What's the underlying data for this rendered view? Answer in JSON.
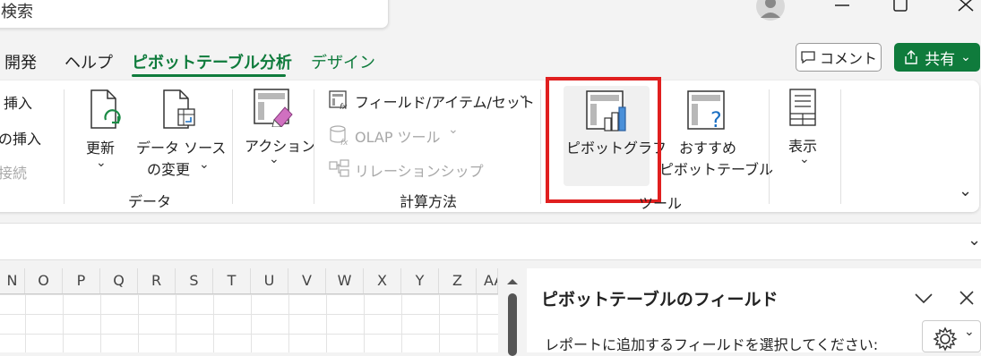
{
  "search": {
    "text": "検索"
  },
  "tabs": [
    {
      "label": "開発"
    },
    {
      "label": "ヘルプ"
    },
    {
      "label": "ピボットテーブル分析"
    },
    {
      "label": "デザイン"
    }
  ],
  "header": {
    "comment": "コメント",
    "share": "共有"
  },
  "ribbon": {
    "insert1": "挿入",
    "insert2": "の挿入",
    "connect": "接続",
    "refresh": "更新",
    "change_source_1": "データ ソース",
    "change_source_2": "の変更",
    "data_group": "データ",
    "actions": "アクション",
    "fields_items_sets": "フィールド/アイテム/セット",
    "olap_tools": "OLAP ツール",
    "relationships": "リレーションシップ",
    "calc_group": "計算方法",
    "pivot_chart": "ピボットグラフ",
    "recommended_1": "おすすめ",
    "recommended_2": "ピボットテーブル",
    "tools_group": "ツール",
    "show": "表示"
  },
  "grid": {
    "columns": [
      "N",
      "O",
      "P",
      "Q",
      "R",
      "S",
      "T",
      "U",
      "V",
      "W",
      "X",
      "Y",
      "Z",
      "AA"
    ]
  },
  "pane": {
    "title": "ピボットテーブルのフィールド",
    "subtitle": "レポートに追加するフィールドを選択してください:"
  },
  "colors": {
    "accent": "#0f7b3c",
    "highlight": "#e01f1f"
  }
}
